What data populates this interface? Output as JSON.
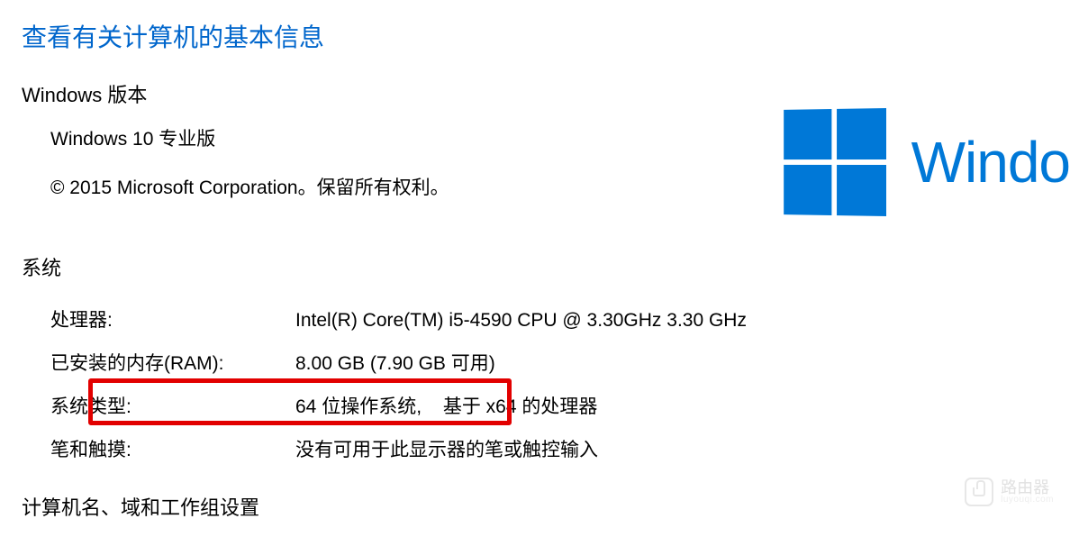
{
  "page_title": "查看有关计算机的基本信息",
  "sections": {
    "windows_edition": {
      "heading": "Windows 版本",
      "edition": "Windows 10 专业版",
      "copyright": "© 2015 Microsoft Corporation。保留所有权利。"
    },
    "system": {
      "heading": "系统",
      "rows": {
        "processor": {
          "label": "处理器:",
          "value": "Intel(R) Core(TM) i5-4590 CPU @ 3.30GHz   3.30 GHz"
        },
        "ram": {
          "label": "已安装的内存(RAM):",
          "value": "8.00 GB (7.90 GB 可用)"
        },
        "system_type": {
          "label": "系统类型:",
          "value_part1": "64 位操作系统,",
          "value_part2": "基于 x64 的处理器"
        },
        "pen_touch": {
          "label": "笔和触摸:",
          "value": "没有可用于此显示器的笔或触控输入"
        }
      }
    },
    "domain_workgroup": {
      "heading": "计算机名、域和工作组设置"
    }
  },
  "logo": {
    "wordmark": "Windo",
    "color": "#0078d7"
  },
  "watermark": {
    "title": "路由器",
    "sub": "luyouqi.com"
  }
}
